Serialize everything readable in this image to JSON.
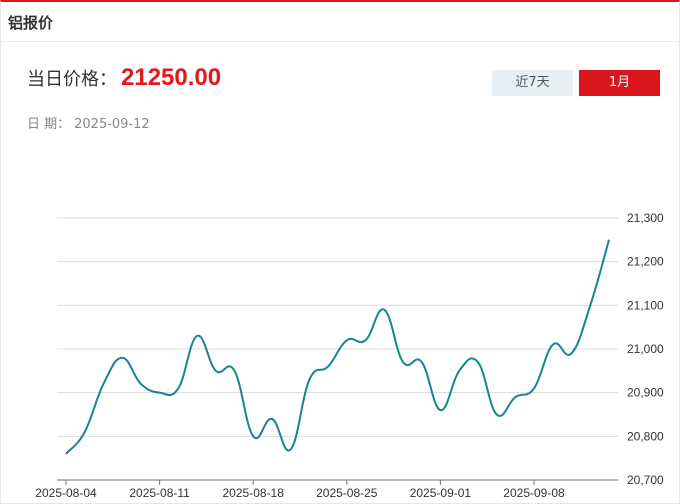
{
  "header": {
    "title": "铝报价"
  },
  "price": {
    "label": "当日价格：",
    "value": "21250.00"
  },
  "date": {
    "label": "日  期：",
    "value": "2025-09-12"
  },
  "tabs": [
    {
      "label": "近7天",
      "active": false
    },
    {
      "label": "1月",
      "active": true
    }
  ],
  "colors": {
    "accent": "#d9161c",
    "line": "#17858b",
    "tab_inactive": "#e8eef6"
  },
  "chart_data": {
    "type": "line",
    "x_tick_labels": [
      "2025-08-04",
      "2025-08-11",
      "2025-08-18",
      "2025-08-25",
      "2025-09-01",
      "2025-09-08"
    ],
    "y_tick_labels": [
      "20,700",
      "20,800",
      "20,900",
      "21,000",
      "21,100",
      "21,200",
      "21,300"
    ],
    "ylim": [
      20700,
      21300
    ],
    "grid": true,
    "series": [
      {
        "values": [
          20760,
          20810,
          20920,
          20980,
          20920,
          20900,
          20910,
          21030,
          20950,
          20950,
          20800,
          20840,
          20770,
          20930,
          20960,
          21020,
          21020,
          21090,
          20970,
          20970,
          20860,
          20950,
          20970,
          20850,
          20890,
          20910,
          21010,
          20990,
          21100,
          21250
        ]
      }
    ]
  }
}
